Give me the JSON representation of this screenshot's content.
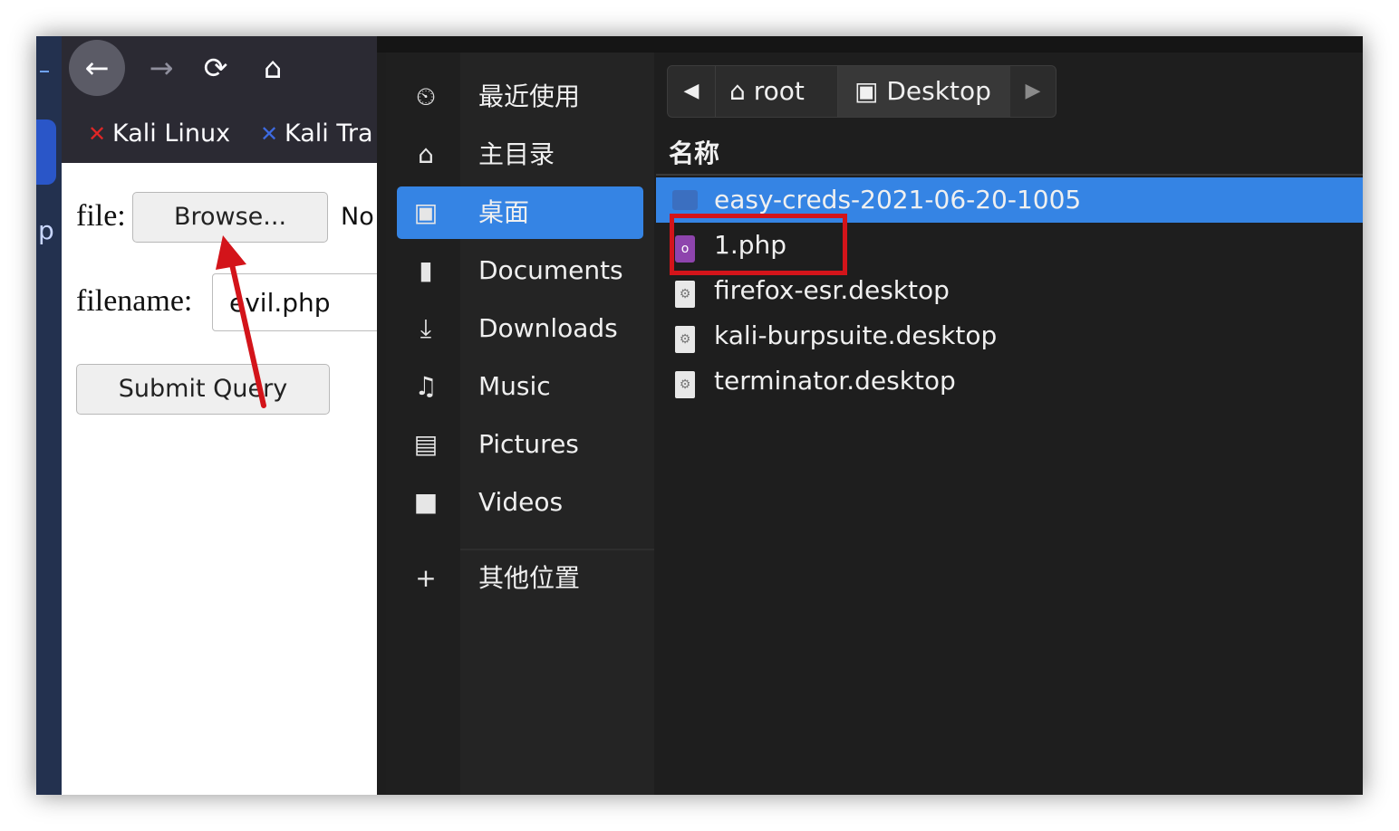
{
  "browser": {
    "nav": {
      "back_icon": "←",
      "forward_icon": "→",
      "reload_icon": "⟳",
      "home_icon": "⌂"
    },
    "bookmarks": [
      {
        "label": "Kali Linux",
        "icon": "kali-dragon-icon"
      },
      {
        "label": "Kali Tra",
        "icon": "kali-tools-icon"
      }
    ],
    "form": {
      "file_label": "file:",
      "browse_label": "Browse...",
      "no_file_text": "No",
      "filename_label": "filename:",
      "filename_value": "evil.php",
      "submit_label": "Submit Query"
    },
    "annotation_color": "#d3141a"
  },
  "side_strip": {
    "letter": "p"
  },
  "chooser": {
    "sidebar": [
      {
        "label": "最近使用",
        "icon": "⏲",
        "selected": false
      },
      {
        "label": "主目录",
        "icon": "⌂",
        "selected": false
      },
      {
        "label": "桌面",
        "icon": "▣",
        "selected": true
      },
      {
        "label": "Documents",
        "icon": "▮",
        "selected": false
      },
      {
        "label": "Downloads",
        "icon": "⤓",
        "selected": false
      },
      {
        "label": "Music",
        "icon": "♫",
        "selected": false
      },
      {
        "label": "Pictures",
        "icon": "▤",
        "selected": false
      },
      {
        "label": "Videos",
        "icon": "■",
        "selected": false
      },
      {
        "label": "其他位置",
        "icon": "+",
        "selected": false
      }
    ],
    "pathbar": {
      "left_icon": "◀",
      "root_icon": "⌂",
      "root_label": "root",
      "desktop_icon": "▣",
      "desktop_label": "Desktop",
      "right_icon": "▶"
    },
    "column_header": "名称",
    "files": [
      {
        "name": "easy-creds-2021-06-20-1005",
        "type": "folder",
        "selected": true
      },
      {
        "name": "1.php",
        "type": "php",
        "selected": false
      },
      {
        "name": "firefox-esr.desktop",
        "type": "desktop",
        "selected": false
      },
      {
        "name": "kali-burpsuite.desktop",
        "type": "desktop",
        "selected": false
      },
      {
        "name": "terminator.desktop",
        "type": "desktop",
        "selected": false
      }
    ],
    "accent_color": "#3584e4"
  }
}
